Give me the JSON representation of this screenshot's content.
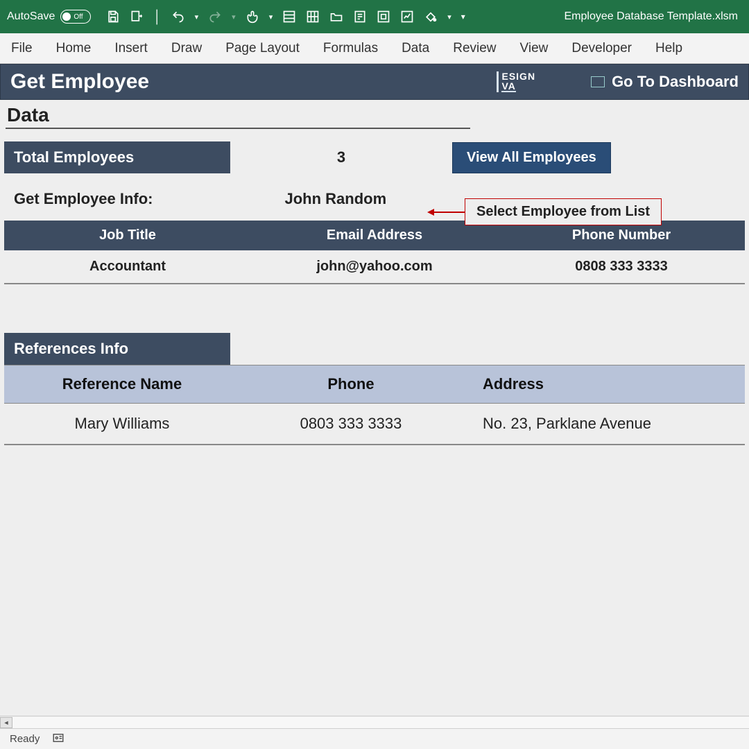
{
  "titlebar": {
    "autosave_label": "AutoSave",
    "autosave_state": "Off",
    "filename": "Employee Database Template.xlsm"
  },
  "ribbon": {
    "tabs": [
      "File",
      "Home",
      "Insert",
      "Draw",
      "Page Layout",
      "Formulas",
      "Data",
      "Review",
      "View",
      "Developer",
      "Help"
    ]
  },
  "app_header": {
    "title": "Get Employee",
    "logo_line1": "ESIGN",
    "logo_line2": "VA",
    "dashboard_link": "Go To Dashboard"
  },
  "sheet": {
    "section_label": "Data",
    "total_employees_label": "Total Employees",
    "total_employees_value": "3",
    "view_all_button": "View All Employees",
    "get_info_label": "Get Employee Info:",
    "selected_employee": "John Random",
    "callout_text": "Select Employee from List",
    "emp_headers": {
      "job": "Job Title",
      "email": "Email Address",
      "phone": "Phone Number"
    },
    "emp_row": {
      "job": "Accountant",
      "email": "john@yahoo.com",
      "phone": "0808 333 3333"
    },
    "refs_label": "References Info",
    "ref_headers": {
      "name": "Reference Name",
      "phone": "Phone",
      "address": "Address"
    },
    "ref_row": {
      "name": "Mary Williams",
      "phone": "0803 333 3333",
      "address": "No. 23, Parklane Avenue"
    }
  },
  "statusbar": {
    "ready": "Ready"
  }
}
